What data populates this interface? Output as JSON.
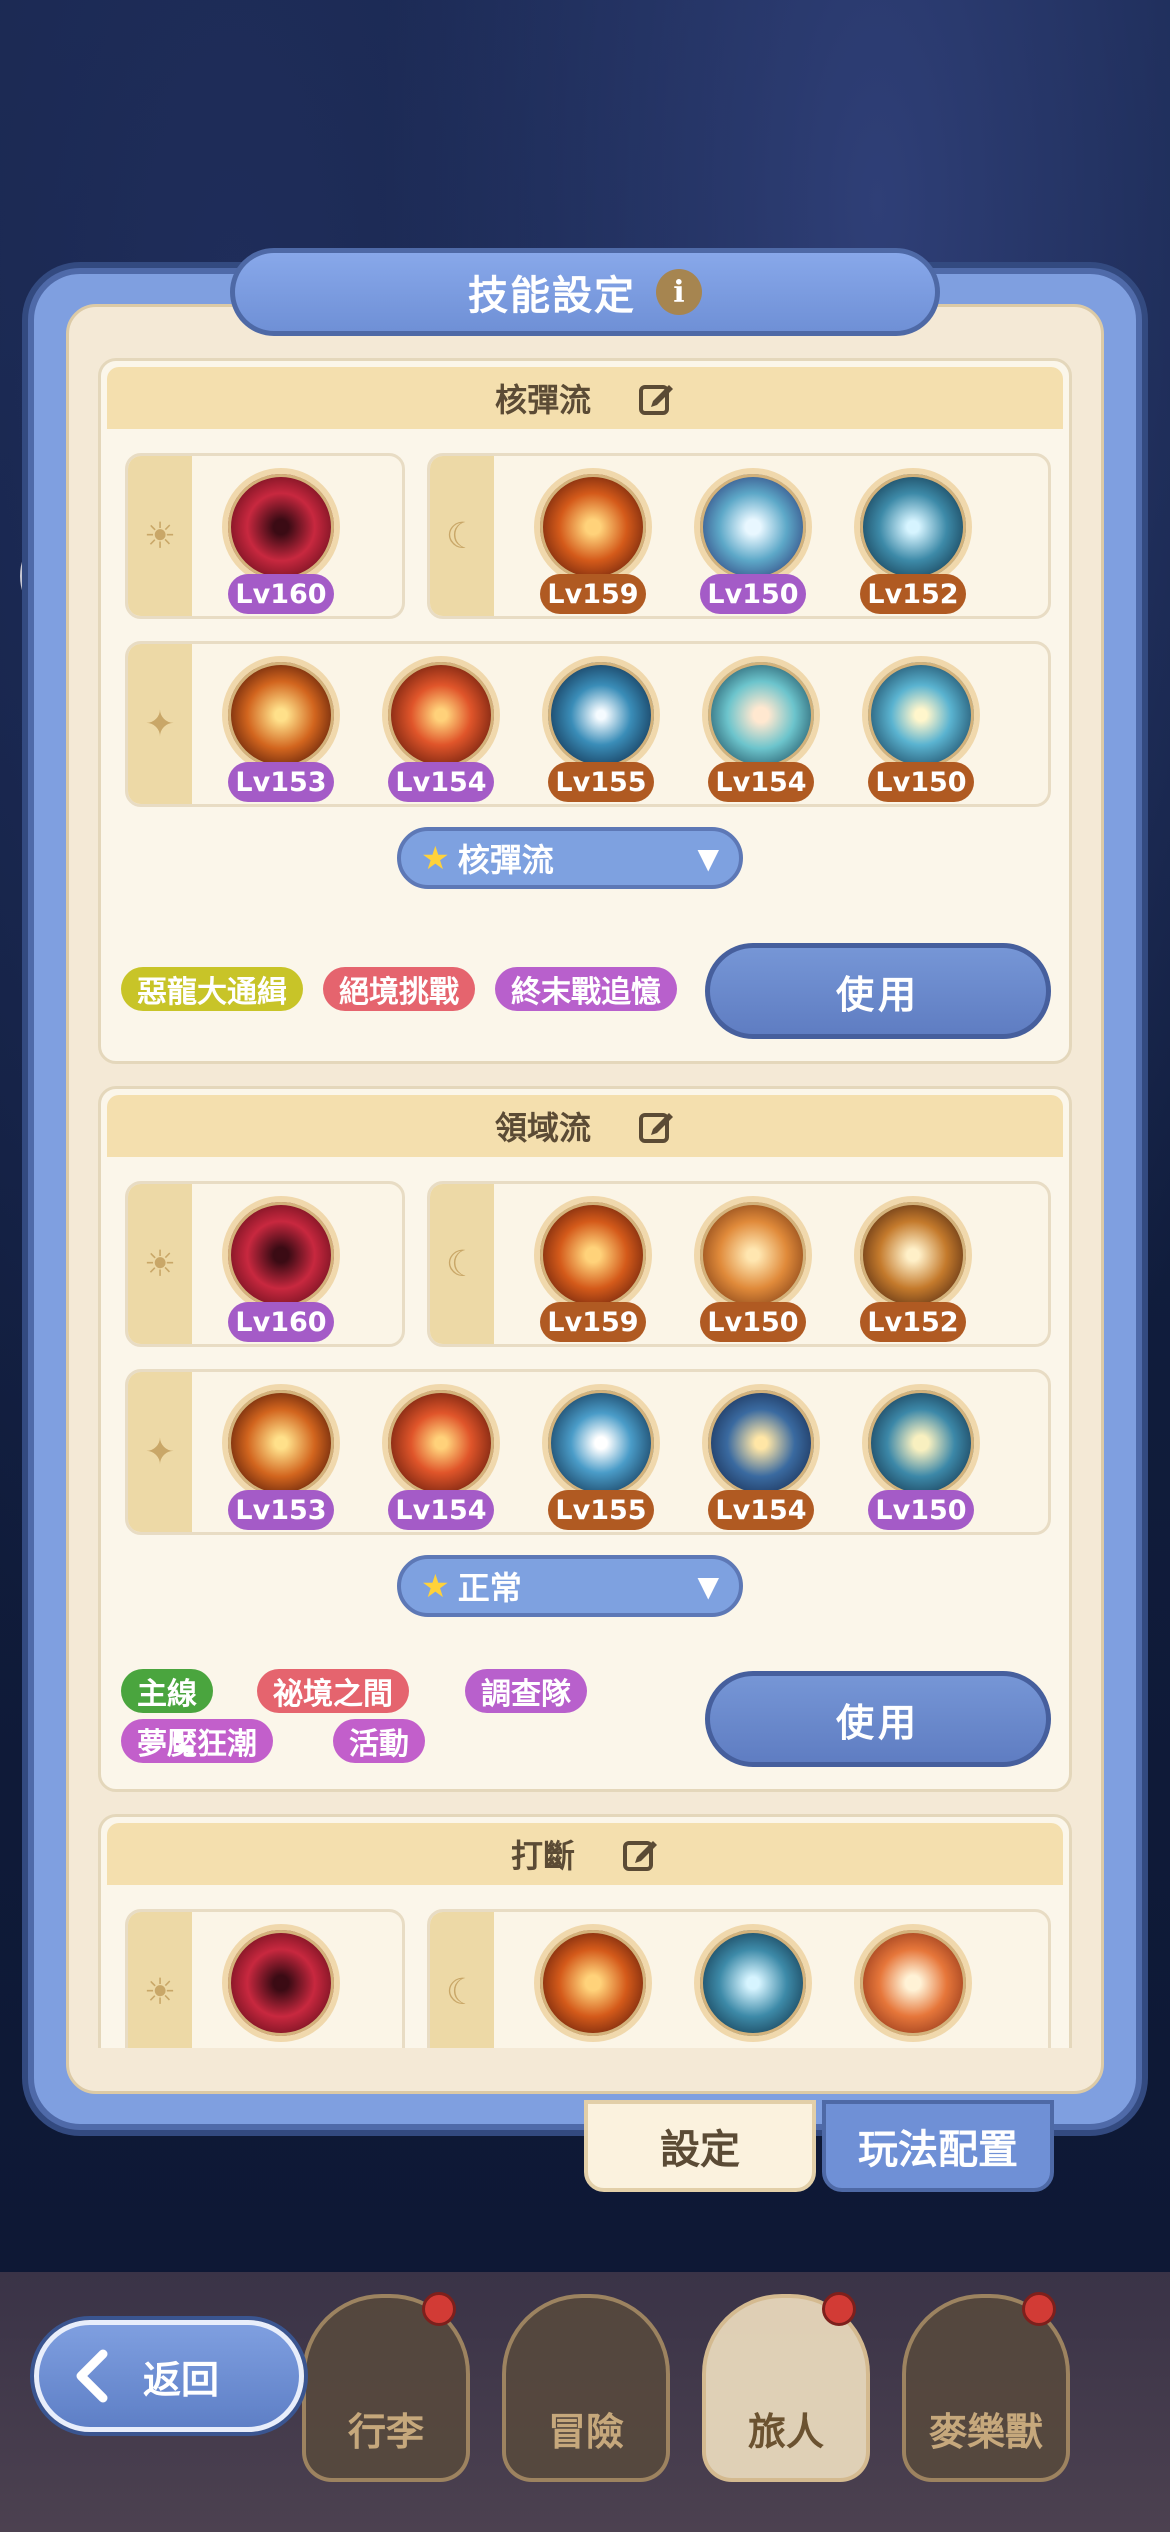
{
  "title": "技能設定",
  "info_icon": "info-icon",
  "colors": {
    "panel_blue": "#7f9fe0",
    "parchment": "#f4e9d6",
    "header_gold": "#f4dfae",
    "lv_purple": "#a45bc7",
    "lv_orange": "#b05a22"
  },
  "loadouts": [
    {
      "name": "核彈流",
      "rows": [
        {
          "icon": "sun-icon",
          "skills": [
            {
              "lv": "Lv160",
              "c": "purple"
            }
          ]
        },
        {
          "icon": "moon-icon",
          "skills": [
            {
              "lv": "Lv159",
              "c": "orange"
            },
            {
              "lv": "Lv150",
              "c": "purple"
            },
            {
              "lv": "Lv152",
              "c": "orange"
            }
          ]
        },
        {
          "icon": "star-icon",
          "skills": [
            {
              "lv": "Lv153",
              "c": "purple"
            },
            {
              "lv": "Lv154",
              "c": "purple"
            },
            {
              "lv": "Lv155",
              "c": "orange"
            },
            {
              "lv": "Lv154",
              "c": "orange"
            },
            {
              "lv": "Lv150",
              "c": "orange"
            }
          ]
        }
      ],
      "dropdown": "核彈流",
      "tags": [
        "惡龍大通緝",
        "絕境挑戰",
        "終末戰追憶"
      ],
      "use": "使用"
    },
    {
      "name": "領域流",
      "rows": [
        {
          "icon": "sun-icon",
          "skills": [
            {
              "lv": "Lv160",
              "c": "purple"
            }
          ]
        },
        {
          "icon": "moon-icon",
          "skills": [
            {
              "lv": "Lv159",
              "c": "orange"
            },
            {
              "lv": "Lv150",
              "c": "orange"
            },
            {
              "lv": "Lv152",
              "c": "orange"
            }
          ]
        },
        {
          "icon": "star-icon",
          "skills": [
            {
              "lv": "Lv153",
              "c": "purple"
            },
            {
              "lv": "Lv154",
              "c": "purple"
            },
            {
              "lv": "Lv155",
              "c": "orange"
            },
            {
              "lv": "Lv154",
              "c": "orange"
            },
            {
              "lv": "Lv150",
              "c": "purple"
            }
          ]
        }
      ],
      "dropdown": "正常",
      "tags": [
        "主線",
        "祕境之間",
        "調查隊",
        "夢魘狂潮",
        "活動"
      ],
      "use": "使用"
    },
    {
      "name": "打斷"
    }
  ],
  "bottom_tabs": {
    "settings": "設定",
    "config": "玩法配置"
  },
  "back": "返回",
  "nav": [
    "行李",
    "冒險",
    "旅人",
    "麥樂獸"
  ]
}
